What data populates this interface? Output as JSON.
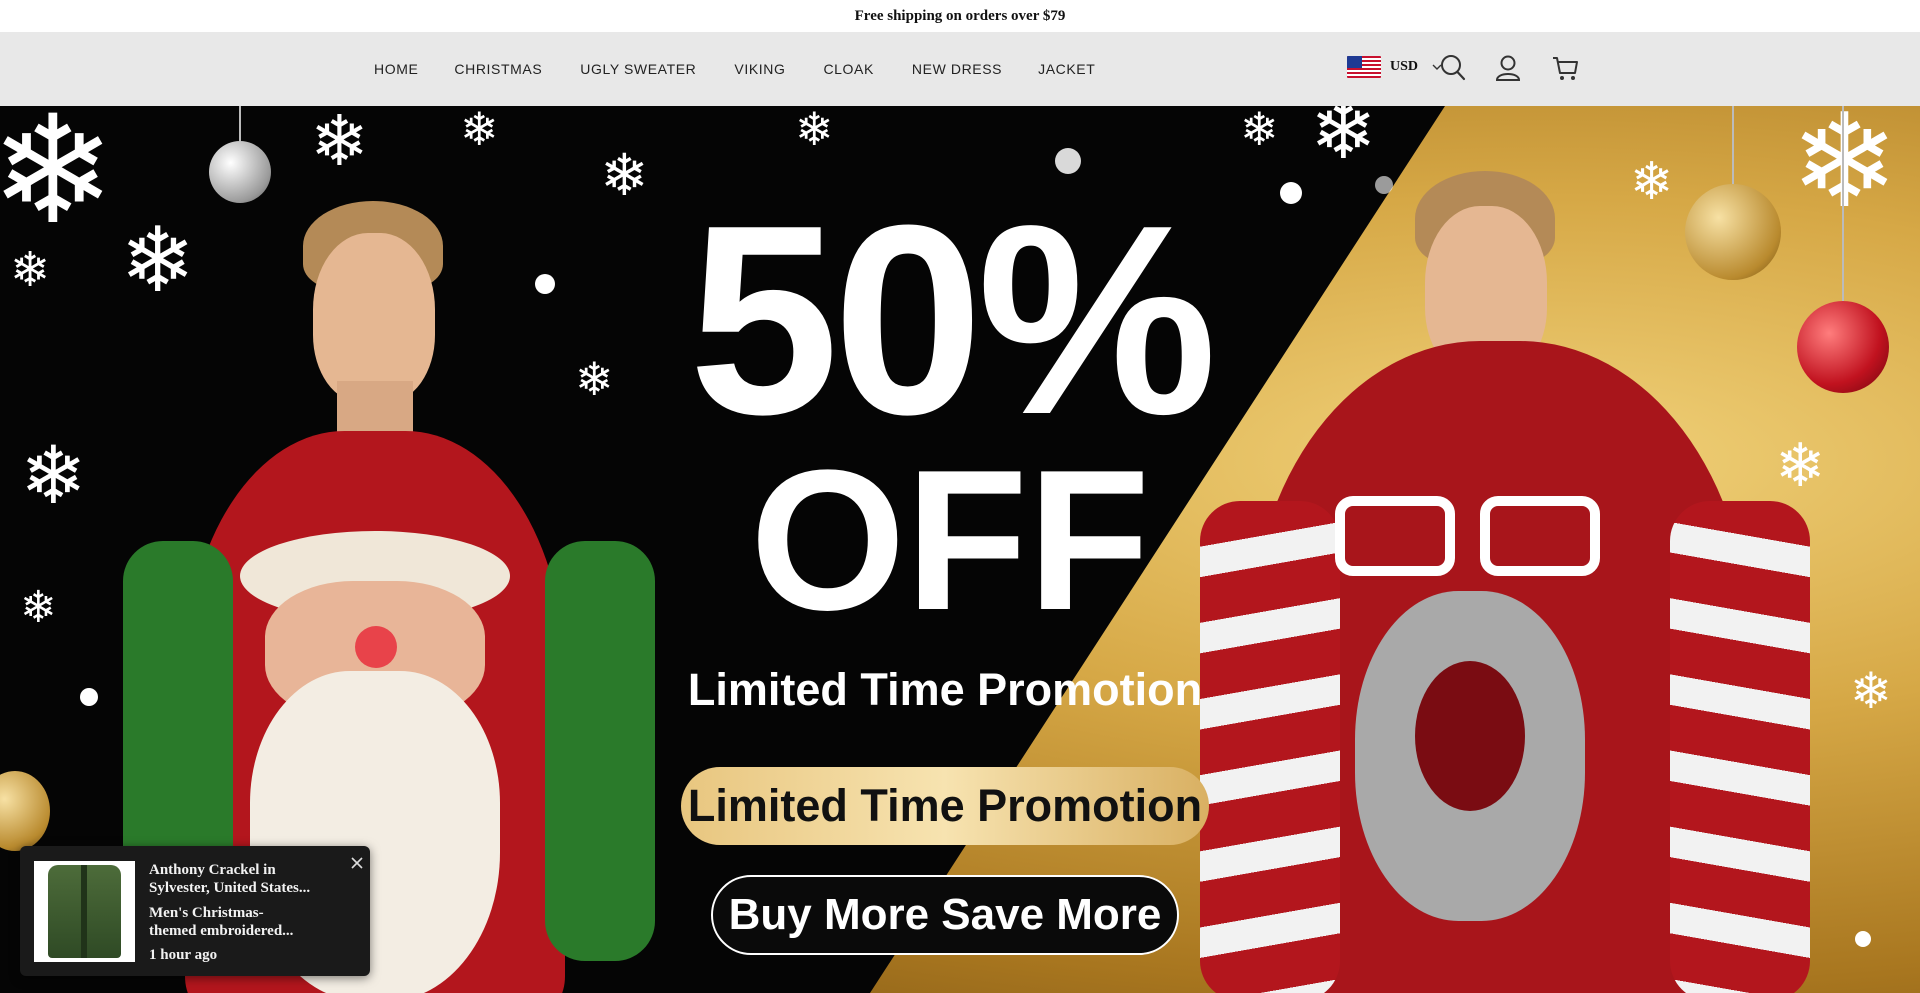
{
  "announcement": {
    "text": "Free shipping on orders over $79"
  },
  "nav": {
    "items": [
      {
        "label": "HOME",
        "caret": ""
      },
      {
        "label": "CHRISTMAS",
        "caret": ""
      },
      {
        "label": "UGLY SWEATER",
        "caret": ""
      },
      {
        "label": "VIKING",
        "caret": ""
      },
      {
        "label": "CLOAK",
        "caret": ""
      },
      {
        "label": "NEW DRESS",
        "caret": ""
      },
      {
        "label": "JACKET",
        "caret": ""
      }
    ]
  },
  "header_tools": {
    "currency": "USD",
    "flag": "us-flag-icon",
    "icons": [
      "chevron-down-icon",
      "search-icon",
      "account-icon",
      "cart-icon"
    ]
  },
  "hero": {
    "headline_percent": "50%",
    "headline_off": "OFF",
    "subline": "Limited Time Promotion",
    "pill_gold": "Limited Time Promotion",
    "cta": "Buy More Save More",
    "colors": {
      "background": "#050505",
      "gold": "#d6a846",
      "sweater_red": "#b3161d"
    }
  },
  "popup": {
    "buyer": "Anthony Crackel in Sylvester, United States...",
    "buyer_line1": "Anthony Crackel in",
    "buyer_line2": "Sylvester, United States...",
    "product_line1": "Men's Christmas-",
    "product_line2": "themed embroidered...",
    "time": "1 hour ago"
  }
}
